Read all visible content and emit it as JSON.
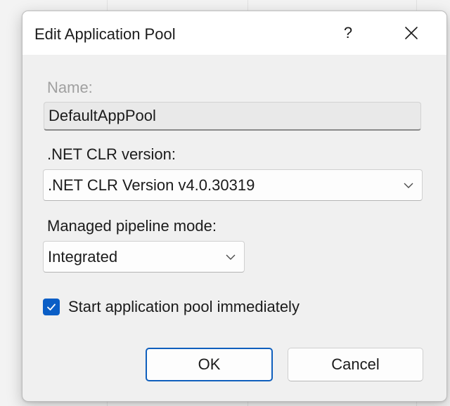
{
  "dialog": {
    "title": "Edit Application Pool",
    "help_glyph": "?",
    "close_icon": "close-icon"
  },
  "name_field": {
    "label": "Name:",
    "value": "DefaultAppPool",
    "disabled": true
  },
  "clr_version": {
    "label": ".NET CLR version:",
    "selected": ".NET CLR Version v4.0.30319"
  },
  "pipeline_mode": {
    "label": "Managed pipeline mode:",
    "selected": "Integrated"
  },
  "start_immediately": {
    "label": "Start application pool immediately",
    "checked": true
  },
  "buttons": {
    "ok": "OK",
    "cancel": "Cancel"
  },
  "colors": {
    "accent": "#0a5ec6",
    "dialog_bg": "#f0f0f0",
    "titlebar_bg": "#ffffff"
  }
}
